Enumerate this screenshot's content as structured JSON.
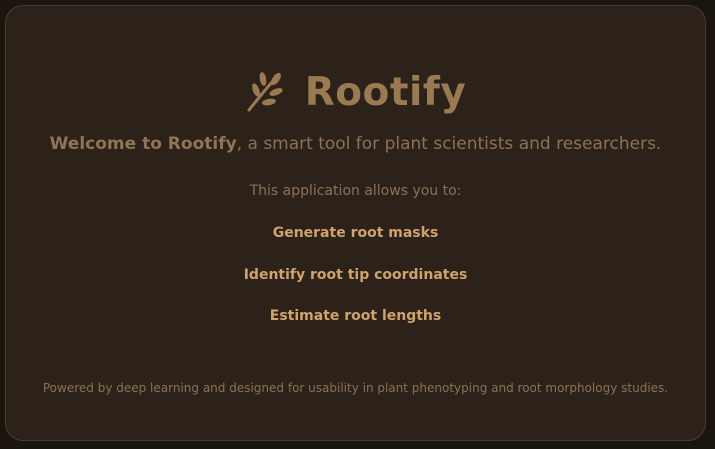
{
  "app": {
    "title": "Rootify",
    "icon": "leaf-branch-icon"
  },
  "welcome": {
    "bold": "Welcome to Rootify",
    "rest": ", a smart tool for plant scientists and researchers."
  },
  "intro": "This application allows you to:",
  "features": [
    "Generate root masks",
    "Identify root tip coordinates",
    "Estimate root lengths"
  ],
  "footer": "Powered by deep learning and designed for usability in plant phenotyping and root morphology studies.",
  "colors": {
    "background": "#1b1510",
    "card": "#2d2219",
    "brand": "#9a7a52",
    "feature": "#d0a26e",
    "muted": "#8a7157"
  }
}
